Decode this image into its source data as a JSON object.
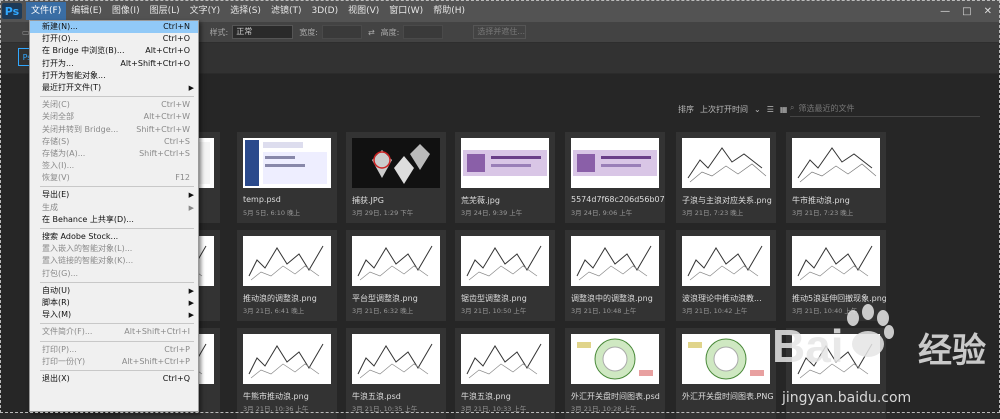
{
  "menubar": {
    "app_icon": "Ps",
    "items": [
      "文件(F)",
      "编辑(E)",
      "图像(I)",
      "图层(L)",
      "文字(Y)",
      "选择(S)",
      "滤镜(T)",
      "3D(D)",
      "视图(V)",
      "窗口(W)",
      "帮助(H)"
    ],
    "active_index": 0,
    "window_controls": [
      "—",
      "□",
      "✕"
    ]
  },
  "optionsbar": {
    "style_label": "样式:",
    "style_value": "正常",
    "width_label": "宽度:",
    "height_label": "高度:",
    "select_mask": "选择并遮住..."
  },
  "home": {
    "start_icon": "Ps",
    "sort_label": "排序",
    "sort_value": "上次打开时间",
    "search_placeholder": "筛选最近的文件"
  },
  "file_menu": [
    {
      "label": "新建(N)...",
      "shortcut": "Ctrl+N",
      "state": "hl"
    },
    {
      "label": "打开(O)...",
      "shortcut": "Ctrl+O"
    },
    {
      "label": "在 Bridge 中浏览(B)...",
      "shortcut": "Alt+Ctrl+O"
    },
    {
      "label": "打开为...",
      "shortcut": "Alt+Shift+Ctrl+O"
    },
    {
      "label": "打开为智能对象..."
    },
    {
      "label": "最近打开文件(T)",
      "arrow": true
    },
    {
      "sep": true
    },
    {
      "label": "关闭(C)",
      "shortcut": "Ctrl+W",
      "state": "disabled"
    },
    {
      "label": "关闭全部",
      "shortcut": "Alt+Ctrl+W",
      "state": "disabled"
    },
    {
      "label": "关闭并转到 Bridge...",
      "shortcut": "Shift+Ctrl+W",
      "state": "disabled"
    },
    {
      "label": "存储(S)",
      "shortcut": "Ctrl+S",
      "state": "disabled"
    },
    {
      "label": "存储为(A)...",
      "shortcut": "Shift+Ctrl+S",
      "state": "disabled"
    },
    {
      "label": "签入(I)...",
      "state": "disabled"
    },
    {
      "label": "恢复(V)",
      "shortcut": "F12",
      "state": "disabled"
    },
    {
      "sep": true
    },
    {
      "label": "导出(E)",
      "arrow": true
    },
    {
      "label": "生成",
      "arrow": true,
      "state": "disabled"
    },
    {
      "label": "在 Behance 上共享(D)..."
    },
    {
      "sep": true
    },
    {
      "label": "搜索 Adobe Stock..."
    },
    {
      "label": "置入嵌入的智能对象(L)...",
      "state": "disabled"
    },
    {
      "label": "置入链接的智能对象(K)...",
      "state": "disabled"
    },
    {
      "label": "打包(G)...",
      "state": "disabled"
    },
    {
      "sep": true
    },
    {
      "label": "自动(U)",
      "arrow": true
    },
    {
      "label": "脚本(R)",
      "arrow": true
    },
    {
      "label": "导入(M)",
      "arrow": true
    },
    {
      "sep": true
    },
    {
      "label": "文件简介(F)...",
      "shortcut": "Alt+Shift+Ctrl+I",
      "state": "disabled"
    },
    {
      "sep": true
    },
    {
      "label": "打印(P)...",
      "shortcut": "Ctrl+P",
      "state": "disabled"
    },
    {
      "label": "打印一份(Y)",
      "shortcut": "Alt+Shift+Ctrl+P",
      "state": "disabled"
    },
    {
      "sep": true
    },
    {
      "label": "退出(X)",
      "shortcut": "Ctrl+Q"
    }
  ],
  "recent_files": [
    {
      "name": "",
      "date": "",
      "kind": "doc"
    },
    {
      "name": "temp.psd",
      "date": "5月 5日, 6:10 晚上",
      "kind": "screen"
    },
    {
      "name": "捕获.JPG",
      "date": "3月 29日, 1:29 下午",
      "kind": "diamond"
    },
    {
      "name": "荒芜薇.jpg",
      "date": "3月 24日, 9:39 上午",
      "kind": "banner"
    },
    {
      "name": "5574d7f68c206d56b07ec5...",
      "date": "3月 24日, 9:06 上午",
      "kind": "banner"
    },
    {
      "name": "子浪与主浪对应关系.png",
      "date": "3月 21日, 7:23 晚上",
      "kind": "wave"
    },
    {
      "name": "牛市推动浪.png",
      "date": "3月 21日, 7:23 晚上",
      "kind": "wave"
    },
    {
      "name": "",
      "date": "",
      "kind": "chart"
    },
    {
      "name": "推动浪的调整浪.png",
      "date": "3月 21日, 6:41 晚上",
      "kind": "chart"
    },
    {
      "name": "平台型调整浪.png",
      "date": "3月 21日, 6:32 晚上",
      "kind": "chart"
    },
    {
      "name": "锯齿型调整浪.png",
      "date": "3月 21日, 10:50 上午",
      "kind": "chart"
    },
    {
      "name": "调整浪中的调整浪.png",
      "date": "3月 21日, 10:48 上午",
      "kind": "chart"
    },
    {
      "name": "波浪理论中推动浪教...",
      "date": "3月 21日, 10:42 上午",
      "kind": "chart"
    },
    {
      "name": "推动5浪延伸回撤现象.png",
      "date": "3月 21日, 10:40 上午",
      "kind": "chart"
    },
    {
      "name": "",
      "date": "",
      "kind": "chart"
    },
    {
      "name": "牛熊市推动浪.png",
      "date": "3月 21日, 10:36 上午",
      "kind": "chart"
    },
    {
      "name": "牛浪五浪.psd",
      "date": "3月 21日, 10:35 上午",
      "kind": "chart"
    },
    {
      "name": "牛浪五浪.png",
      "date": "3月 21日, 10:33 上午",
      "kind": "chart"
    },
    {
      "name": "外汇开关盘时间图表.psd",
      "date": "3月 21日, 10:28 上午",
      "kind": "clock"
    },
    {
      "name": "外汇开关盘时间图表.PNG",
      "date": "",
      "kind": "clock"
    },
    {
      "name": "",
      "date": "",
      "kind": "chart"
    }
  ],
  "watermark": {
    "brand": "Bai",
    "brand2": "经验",
    "url": "jingyan.baidu.com"
  }
}
